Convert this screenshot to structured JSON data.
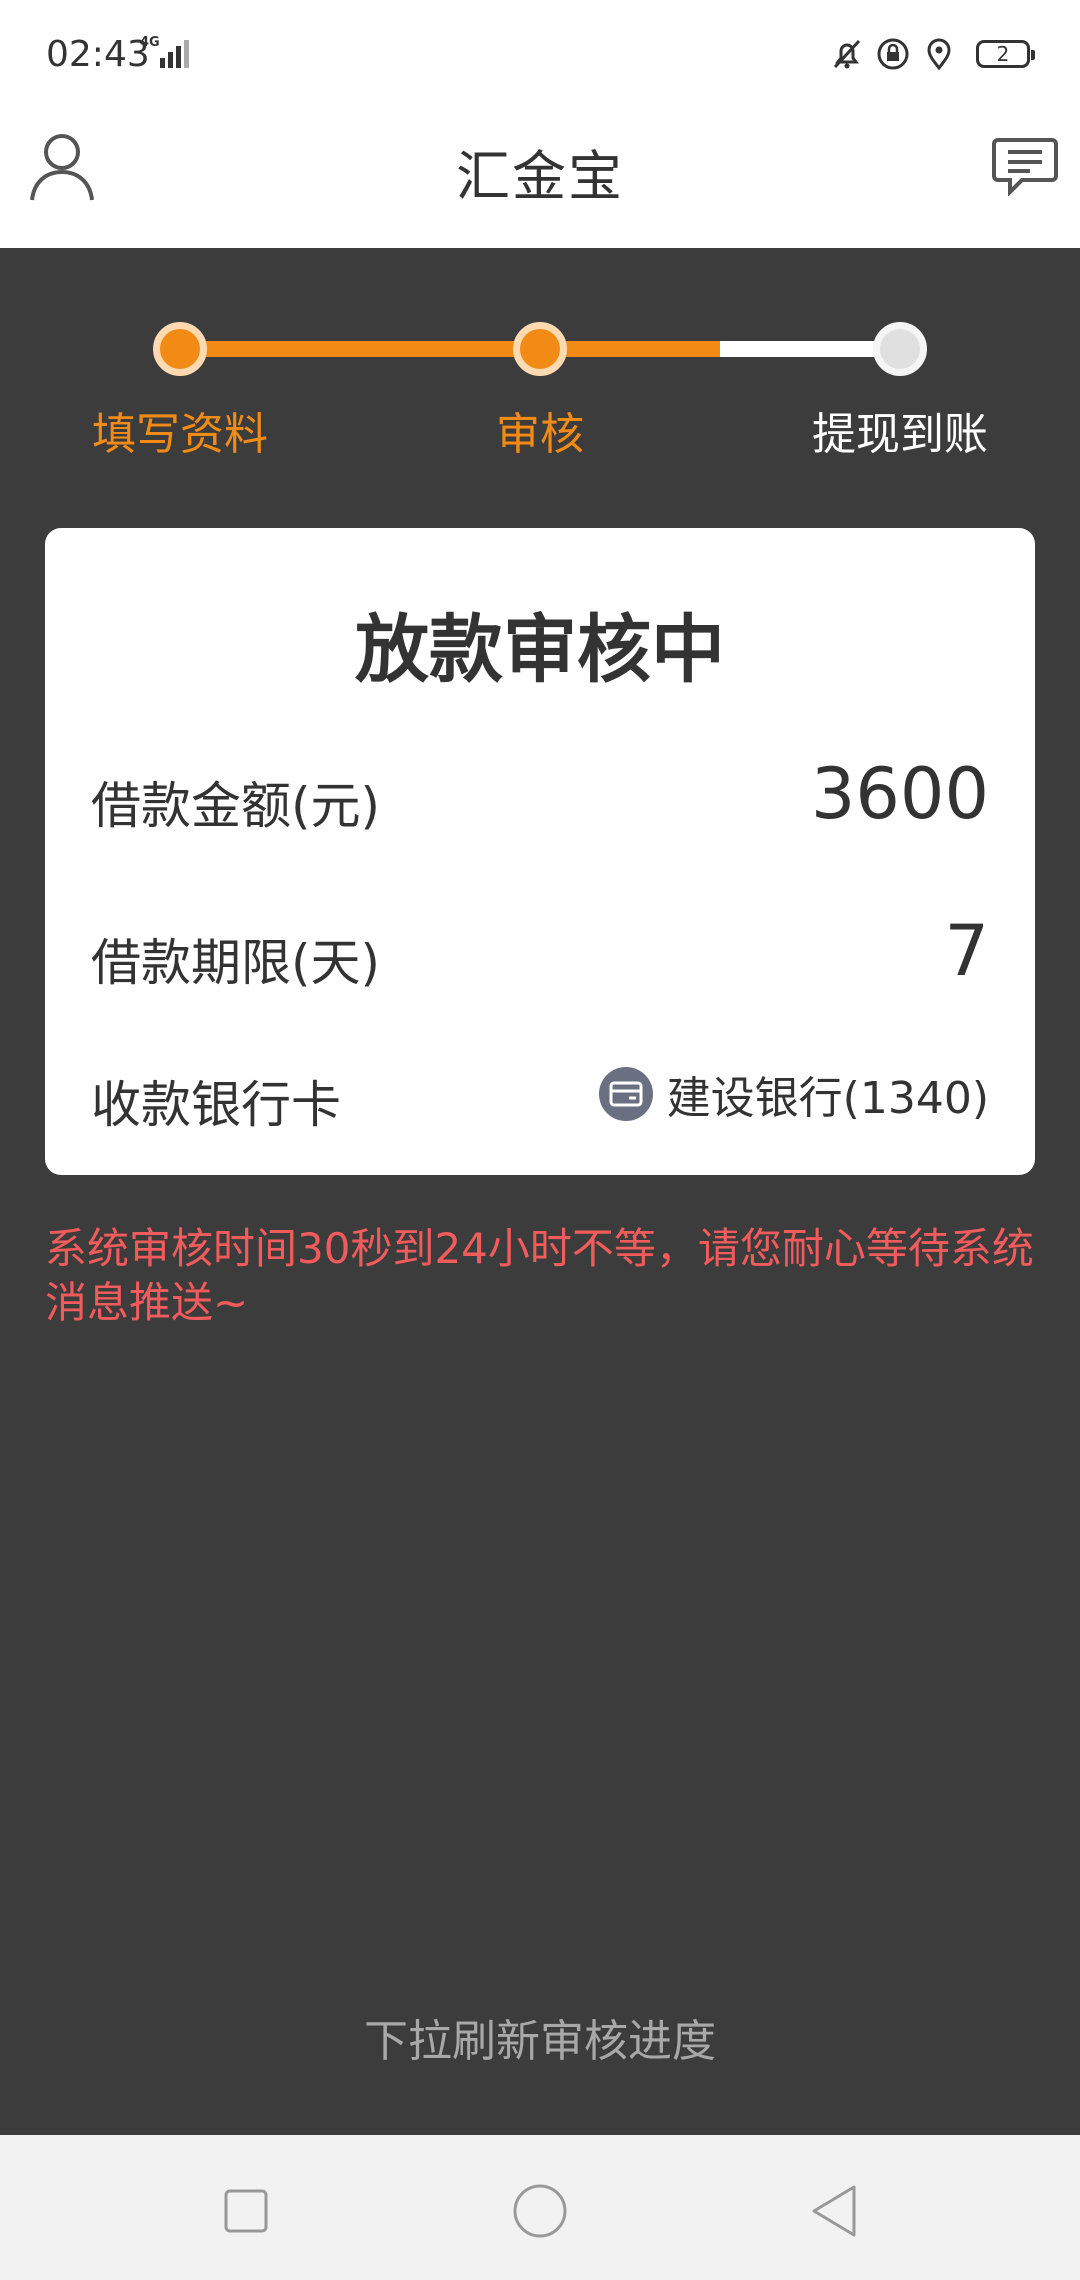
{
  "status_bar": {
    "time": "02:43",
    "network": "4G",
    "battery": "2",
    "icons": [
      "bell-off-icon",
      "lock-rotation-icon",
      "location-icon",
      "battery-icon"
    ]
  },
  "header": {
    "title": "汇金宝",
    "left_icon": "user-icon",
    "right_icon": "message-icon"
  },
  "steps": [
    {
      "label": "填写资料",
      "state": "done"
    },
    {
      "label": "审核",
      "state": "active"
    },
    {
      "label": "提现到账",
      "state": "pending"
    }
  ],
  "card": {
    "title": "放款审核中",
    "rows": [
      {
        "label": "借款金额(元)",
        "value": "3600"
      },
      {
        "label": "借款期限(天)",
        "value": "7"
      },
      {
        "label": "收款银行卡",
        "value": "建设银行(1340)",
        "icon": "bank-card-icon"
      }
    ]
  },
  "notice": "系统审核时间30秒到24小时不等，请您耐心等待系统消息推送~",
  "pull_hint": "下拉刷新审核进度",
  "navbar": {
    "buttons": [
      "recent-apps",
      "home",
      "back"
    ]
  },
  "colors": {
    "accent": "#f28a16",
    "background": "#3c3c3c",
    "notice": "#f25b5b"
  }
}
